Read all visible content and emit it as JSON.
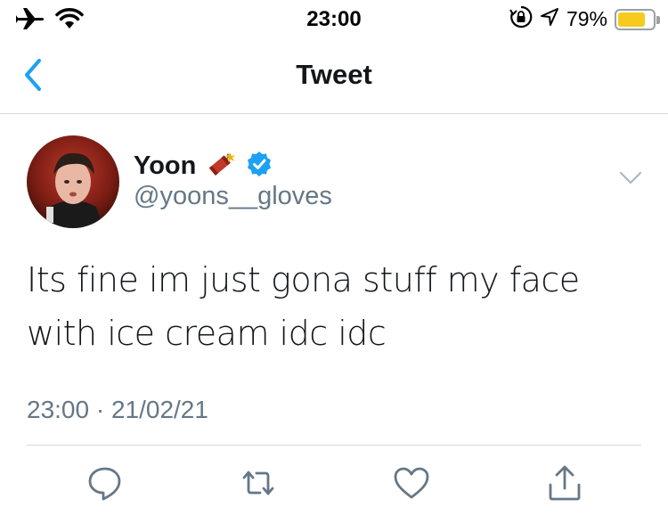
{
  "status_bar": {
    "time": "23:00",
    "battery_percent_text": "79%",
    "battery_level": 0.79,
    "battery_color": "#f6cb1e",
    "icons": [
      "airplane-icon",
      "wifi-icon",
      "orientation-lock-icon",
      "location-icon",
      "battery-icon"
    ]
  },
  "nav": {
    "title": "Tweet",
    "back_icon": "chevron-left-icon",
    "accent_color": "#1da1f2"
  },
  "tweet": {
    "author": {
      "display_name": "Yoon",
      "emoji": "🧨",
      "verified": true,
      "handle": "@yoons__gloves"
    },
    "text": "Its fine im just gona stuff my face with ice cream idc idc",
    "timestamp": "23:00 · 21/02/21"
  },
  "actions": [
    {
      "name": "reply",
      "icon": "reply-icon"
    },
    {
      "name": "retweet",
      "icon": "retweet-icon"
    },
    {
      "name": "like",
      "icon": "heart-icon"
    },
    {
      "name": "share",
      "icon": "share-icon"
    }
  ]
}
